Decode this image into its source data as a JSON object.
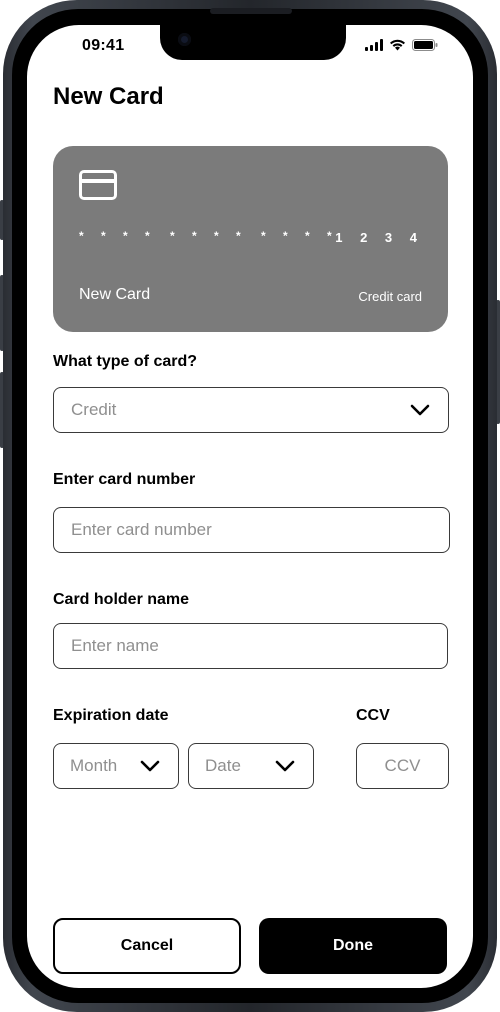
{
  "status_bar": {
    "time": "09:41",
    "icons": [
      "signal-icon",
      "wifi-icon",
      "battery-icon"
    ]
  },
  "header": {
    "title": "New Card"
  },
  "card_preview": {
    "icon": "credit-card-icon",
    "masked_groups": [
      "* * * *",
      "* * * *",
      "* * * *"
    ],
    "last_digits": "1 2 3 4",
    "holder_name": "New Card",
    "card_type": "Credit card",
    "background_color": "#7b7b7b"
  },
  "form": {
    "card_type": {
      "label": "What type of card?",
      "selected": "Credit",
      "icon": "chevron-down-icon"
    },
    "card_number": {
      "label": "Enter card number",
      "placeholder": "Enter card number"
    },
    "holder_name": {
      "label": "Card holder name",
      "placeholder": "Enter name"
    },
    "expiration": {
      "label": "Expiration date",
      "month": {
        "selected": "Month",
        "icon": "chevron-down-icon"
      },
      "date": {
        "selected": "Date",
        "icon": "chevron-down-icon"
      }
    },
    "ccv": {
      "label": "CCV",
      "placeholder": "CCV"
    }
  },
  "actions": {
    "cancel_label": "Cancel",
    "done_label": "Done"
  }
}
